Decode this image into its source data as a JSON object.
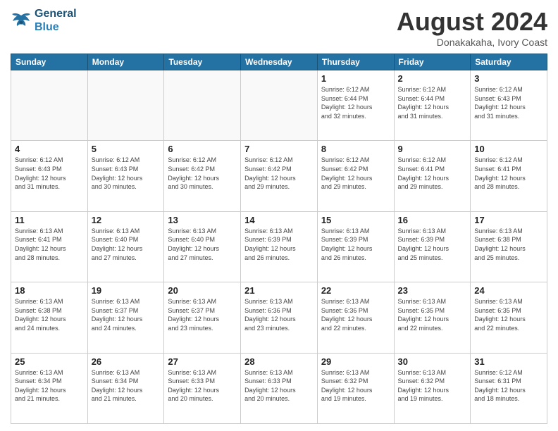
{
  "header": {
    "logo_line1": "General",
    "logo_line2": "Blue",
    "month": "August 2024",
    "location": "Donakakaha, Ivory Coast"
  },
  "weekdays": [
    "Sunday",
    "Monday",
    "Tuesday",
    "Wednesday",
    "Thursday",
    "Friday",
    "Saturday"
  ],
  "weeks": [
    [
      {
        "day": "",
        "info": ""
      },
      {
        "day": "",
        "info": ""
      },
      {
        "day": "",
        "info": ""
      },
      {
        "day": "",
        "info": ""
      },
      {
        "day": "1",
        "info": "Sunrise: 6:12 AM\nSunset: 6:44 PM\nDaylight: 12 hours\nand 32 minutes."
      },
      {
        "day": "2",
        "info": "Sunrise: 6:12 AM\nSunset: 6:44 PM\nDaylight: 12 hours\nand 31 minutes."
      },
      {
        "day": "3",
        "info": "Sunrise: 6:12 AM\nSunset: 6:43 PM\nDaylight: 12 hours\nand 31 minutes."
      }
    ],
    [
      {
        "day": "4",
        "info": "Sunrise: 6:12 AM\nSunset: 6:43 PM\nDaylight: 12 hours\nand 31 minutes."
      },
      {
        "day": "5",
        "info": "Sunrise: 6:12 AM\nSunset: 6:43 PM\nDaylight: 12 hours\nand 30 minutes."
      },
      {
        "day": "6",
        "info": "Sunrise: 6:12 AM\nSunset: 6:42 PM\nDaylight: 12 hours\nand 30 minutes."
      },
      {
        "day": "7",
        "info": "Sunrise: 6:12 AM\nSunset: 6:42 PM\nDaylight: 12 hours\nand 29 minutes."
      },
      {
        "day": "8",
        "info": "Sunrise: 6:12 AM\nSunset: 6:42 PM\nDaylight: 12 hours\nand 29 minutes."
      },
      {
        "day": "9",
        "info": "Sunrise: 6:12 AM\nSunset: 6:41 PM\nDaylight: 12 hours\nand 29 minutes."
      },
      {
        "day": "10",
        "info": "Sunrise: 6:12 AM\nSunset: 6:41 PM\nDaylight: 12 hours\nand 28 minutes."
      }
    ],
    [
      {
        "day": "11",
        "info": "Sunrise: 6:13 AM\nSunset: 6:41 PM\nDaylight: 12 hours\nand 28 minutes."
      },
      {
        "day": "12",
        "info": "Sunrise: 6:13 AM\nSunset: 6:40 PM\nDaylight: 12 hours\nand 27 minutes."
      },
      {
        "day": "13",
        "info": "Sunrise: 6:13 AM\nSunset: 6:40 PM\nDaylight: 12 hours\nand 27 minutes."
      },
      {
        "day": "14",
        "info": "Sunrise: 6:13 AM\nSunset: 6:39 PM\nDaylight: 12 hours\nand 26 minutes."
      },
      {
        "day": "15",
        "info": "Sunrise: 6:13 AM\nSunset: 6:39 PM\nDaylight: 12 hours\nand 26 minutes."
      },
      {
        "day": "16",
        "info": "Sunrise: 6:13 AM\nSunset: 6:39 PM\nDaylight: 12 hours\nand 25 minutes."
      },
      {
        "day": "17",
        "info": "Sunrise: 6:13 AM\nSunset: 6:38 PM\nDaylight: 12 hours\nand 25 minutes."
      }
    ],
    [
      {
        "day": "18",
        "info": "Sunrise: 6:13 AM\nSunset: 6:38 PM\nDaylight: 12 hours\nand 24 minutes."
      },
      {
        "day": "19",
        "info": "Sunrise: 6:13 AM\nSunset: 6:37 PM\nDaylight: 12 hours\nand 24 minutes."
      },
      {
        "day": "20",
        "info": "Sunrise: 6:13 AM\nSunset: 6:37 PM\nDaylight: 12 hours\nand 23 minutes."
      },
      {
        "day": "21",
        "info": "Sunrise: 6:13 AM\nSunset: 6:36 PM\nDaylight: 12 hours\nand 23 minutes."
      },
      {
        "day": "22",
        "info": "Sunrise: 6:13 AM\nSunset: 6:36 PM\nDaylight: 12 hours\nand 22 minutes."
      },
      {
        "day": "23",
        "info": "Sunrise: 6:13 AM\nSunset: 6:35 PM\nDaylight: 12 hours\nand 22 minutes."
      },
      {
        "day": "24",
        "info": "Sunrise: 6:13 AM\nSunset: 6:35 PM\nDaylight: 12 hours\nand 22 minutes."
      }
    ],
    [
      {
        "day": "25",
        "info": "Sunrise: 6:13 AM\nSunset: 6:34 PM\nDaylight: 12 hours\nand 21 minutes."
      },
      {
        "day": "26",
        "info": "Sunrise: 6:13 AM\nSunset: 6:34 PM\nDaylight: 12 hours\nand 21 minutes."
      },
      {
        "day": "27",
        "info": "Sunrise: 6:13 AM\nSunset: 6:33 PM\nDaylight: 12 hours\nand 20 minutes."
      },
      {
        "day": "28",
        "info": "Sunrise: 6:13 AM\nSunset: 6:33 PM\nDaylight: 12 hours\nand 20 minutes."
      },
      {
        "day": "29",
        "info": "Sunrise: 6:13 AM\nSunset: 6:32 PM\nDaylight: 12 hours\nand 19 minutes."
      },
      {
        "day": "30",
        "info": "Sunrise: 6:13 AM\nSunset: 6:32 PM\nDaylight: 12 hours\nand 19 minutes."
      },
      {
        "day": "31",
        "info": "Sunrise: 6:12 AM\nSunset: 6:31 PM\nDaylight: 12 hours\nand 18 minutes."
      }
    ]
  ]
}
